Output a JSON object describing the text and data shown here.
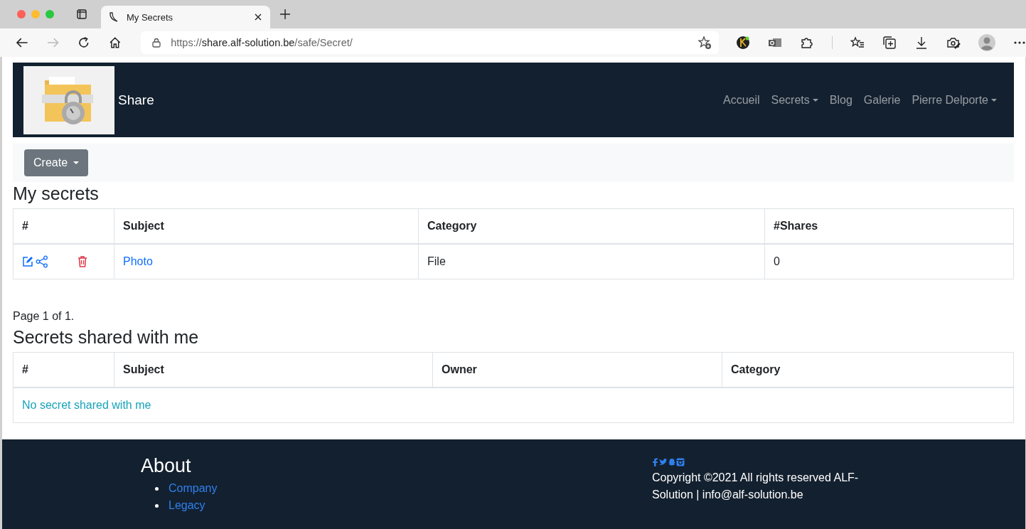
{
  "browser": {
    "tab_title": "My Secrets",
    "url_scheme": "https://",
    "url_host": "share.alf-solution.be",
    "url_path": "/safe/Secret/"
  },
  "navbar": {
    "brand": "Share",
    "items": [
      {
        "label": "Accueil",
        "dropdown": false
      },
      {
        "label": "Secrets",
        "dropdown": true
      },
      {
        "label": "Blog",
        "dropdown": false
      },
      {
        "label": "Galerie",
        "dropdown": false
      },
      {
        "label": "Pierre Delporte",
        "dropdown": true
      }
    ]
  },
  "toolbar": {
    "create_button": "Create"
  },
  "my_secrets": {
    "title": "My secrets",
    "columns": [
      "#",
      "Subject",
      "Category",
      "#Shares"
    ],
    "rows": [
      {
        "subject": "Photo",
        "category": "File",
        "shares": "0"
      }
    ],
    "pagination": "Page 1 of 1."
  },
  "shared_secrets": {
    "title": "Secrets shared with me",
    "columns": [
      "#",
      "Subject",
      "Owner",
      "Category"
    ],
    "empty_message": "No secret shared with me"
  },
  "footer": {
    "about_title": "About",
    "links": [
      "Company",
      "Legacy"
    ],
    "copyright": "Copyright ©2021 All rights reserved ALF-Solution | info@alf-solution.be"
  }
}
